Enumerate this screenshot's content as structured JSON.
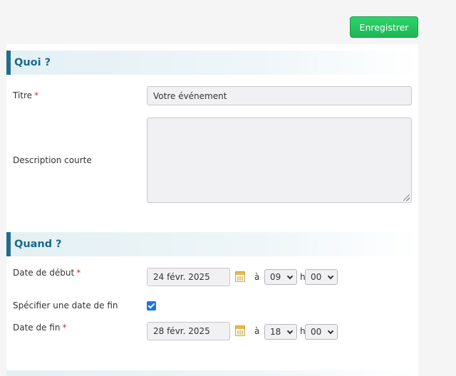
{
  "toolbar": {
    "save_label": "Enregistrer"
  },
  "quoi": {
    "heading": "Quoi ?",
    "titre_label": "Titre",
    "required_mark": "*",
    "titre_value": "Votre événement",
    "description_label": "Description courte",
    "description_value": ""
  },
  "quand": {
    "heading": "Quand ?",
    "start_label": "Date de début",
    "start_date": "24 févr. 2025",
    "start_hour": "09",
    "start_minute": "00",
    "at_label": "à",
    "h_label": "h",
    "specify_end_label": "Spécifier une date de fin",
    "specify_end_checked": true,
    "end_label": "Date de fin",
    "end_date": "28 févr. 2025",
    "end_hour": "18",
    "end_minute": "00"
  }
}
